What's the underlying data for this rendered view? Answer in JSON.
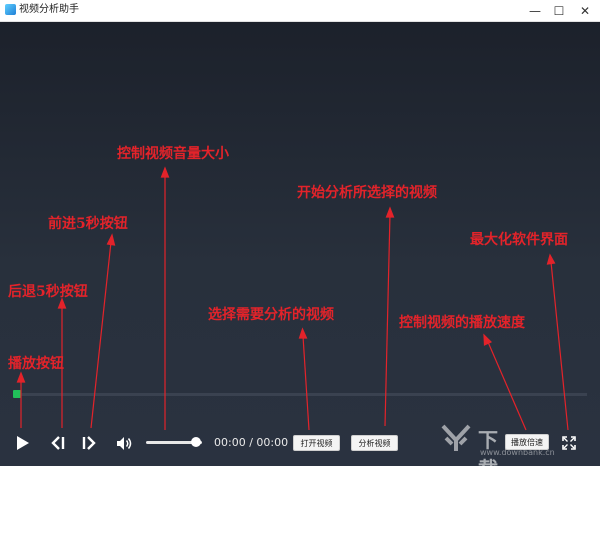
{
  "window": {
    "title": "视频分析助手",
    "minimize_glyph": "—",
    "maximize_glyph": "☐",
    "close_glyph": "✕"
  },
  "player": {
    "time_display": "00:00 / 00:00",
    "open_video_label": "打开视频",
    "analyze_video_label": "分析视频",
    "speed_label": "播放倍速",
    "progress_fraction": 0.0,
    "volume_fraction": 0.9,
    "accent_color": "#21c05a"
  },
  "annotations": {
    "play": "播放按钮",
    "rewind": "后退5秒按钮",
    "forward": "前进5秒按钮",
    "volume": "控制视频音量大小",
    "select": "选择需要分析的视频",
    "analyze": "开始分析所选择的视频",
    "speed": "控制视频的播放速度",
    "maximize": "最大化软件界面",
    "color": "#e3232a"
  },
  "watermark": {
    "name": "下载银行",
    "url": "www.downbank.cn"
  }
}
